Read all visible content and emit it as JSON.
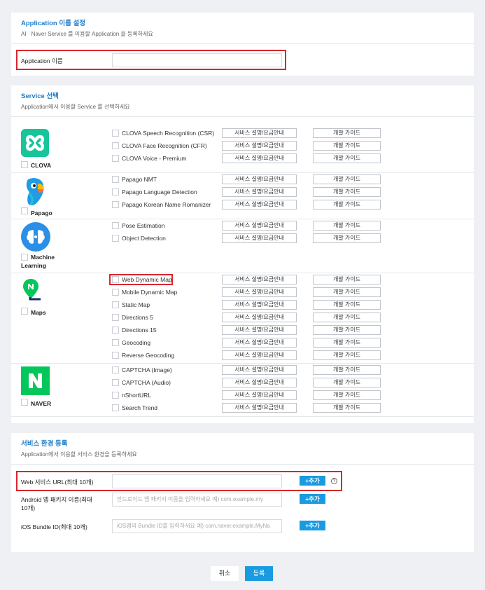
{
  "app_name_section": {
    "title": "Application 이름 설정",
    "subtitle": "AI · Naver Service 를 이용할 Application 을 등록하세요",
    "field_label": "Application 이름",
    "field_value": ""
  },
  "service_section": {
    "title": "Service 선택",
    "subtitle": "Application에서 이용할 Service 를 선택하세요",
    "detail_button_label": "서비스 설명/요금안내",
    "guide_button_label": "개발 가이드",
    "categories": [
      {
        "name": "CLOVA",
        "logo": "clova-logo",
        "services": [
          "CLOVA Speech Recognition (CSR)",
          "CLOVA Face Recognition (CFR)",
          "CLOVA Voice - Premium"
        ]
      },
      {
        "name": "Papago",
        "logo": "papago-logo",
        "services": [
          "Papago NMT",
          "Papago Language Detection",
          "Papago Korean Name Romanizer"
        ]
      },
      {
        "name_line1": "Machine",
        "name_line2": "Learning",
        "logo": "machine-learning-logo",
        "services": [
          "Pose Estimation",
          "Object Detection"
        ]
      },
      {
        "name": "Maps",
        "logo": "maps-logo",
        "services": [
          "Web Dynamic Map",
          "Mobile Dynamic Map",
          "Static Map",
          "Directions 5",
          "Directions 15",
          "Geocoding",
          "Reverse Geocoding"
        ]
      },
      {
        "name": "NAVER",
        "logo": "naver-logo",
        "services": [
          "CAPTCHA (Image)",
          "CAPTCHA (Audio)",
          "nShortURL",
          "Search Trend"
        ]
      }
    ]
  },
  "env_section": {
    "title": "서비스 환경 등록",
    "subtitle": "Application에서 이용할 서비스 환경을 등록하세요",
    "add_label": "+추가",
    "help_icon": "?",
    "web_label": "Web 서비스 URL(최대 10개)",
    "web_value": "",
    "android_label_line1": "Android 앱 패키지 이름(최대",
    "android_label_line2": "10개)",
    "android_placeholder": "안드로이드 앱 패키지 이름을 입력하세요 예) com.example.my",
    "ios_label": "iOS Bundle ID(최대 10개)",
    "ios_placeholder": "iOS앱의 Bundle ID를 입력하세요 예) com.naver.example.MyNa"
  },
  "footer": {
    "cancel_label": "취소",
    "submit_label": "등록"
  },
  "colors": {
    "accent": "#1f7cc8",
    "primary_button": "#1a9be0",
    "highlight": "#d8262c",
    "clova": "#17c59a",
    "naver": "#03c75a"
  }
}
